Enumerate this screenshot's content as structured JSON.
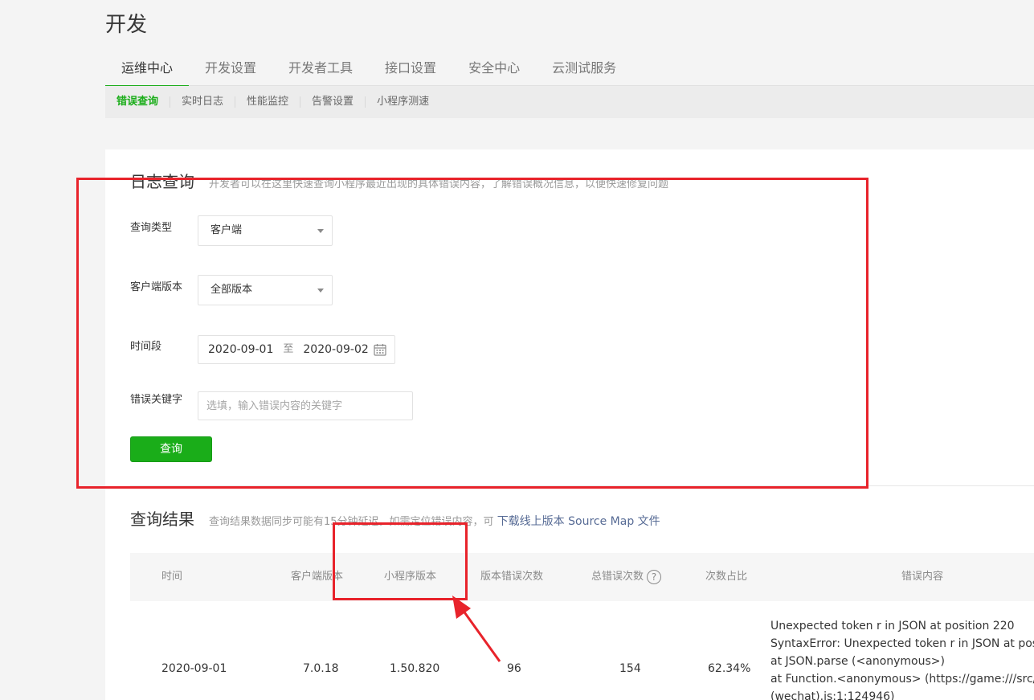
{
  "page": {
    "title": "开发"
  },
  "main_tabs": [
    {
      "label": "运维中心",
      "active": true
    },
    {
      "label": "开发设置",
      "active": false
    },
    {
      "label": "开发者工具",
      "active": false
    },
    {
      "label": "接口设置",
      "active": false
    },
    {
      "label": "安全中心",
      "active": false
    },
    {
      "label": "云测试服务",
      "active": false
    }
  ],
  "sub_tabs": [
    {
      "label": "错误查询",
      "active": true
    },
    {
      "label": "实时日志",
      "active": false
    },
    {
      "label": "性能监控",
      "active": false
    },
    {
      "label": "告警设置",
      "active": false
    },
    {
      "label": "小程序测速",
      "active": false
    }
  ],
  "log_query": {
    "title": "日志查询",
    "desc": "开发者可以在这里快速查询小程序最近出现的具体错误内容，了解错误概况信息，以便快速修复问题",
    "query_type_label": "查询类型",
    "query_type_value": "客户端",
    "client_version_label": "客户端版本",
    "client_version_value": "全部版本",
    "period_label": "时间段",
    "date_start": "2020-09-01",
    "date_sep": "至",
    "date_end": "2020-09-02",
    "keyword_label": "错误关键字",
    "keyword_placeholder": "选填，输入错误内容的关键字",
    "keyword_value": "",
    "query_button": "查询"
  },
  "results": {
    "title": "查询结果",
    "desc": "查询结果数据同步可能有15分钟延迟。如需定位错误内容，可",
    "link": "下载线上版本 Source Map 文件",
    "columns": {
      "time": "时间",
      "client_version": "客户端版本",
      "mp_version": "小程序版本",
      "version_errors": "版本错误次数",
      "total_errors": "总错误次数",
      "ratio": "次数占比",
      "error_content": "错误内容"
    },
    "rows": [
      {
        "time": "2020-09-01",
        "client_version": "7.0.18",
        "mp_version": "1.50.820",
        "version_errors": "96",
        "total_errors": "154",
        "ratio": "62.34%",
        "error_lines": [
          "Unexpected token r in JSON at position 220",
          "SyntaxError: Unexpected token r in JSON at posit",
          "at JSON.parse (<anonymous>)",
          "at Function.<anonymous> (https://game:///src/a",
          "(wechat).js:1:124946)"
        ]
      }
    ]
  },
  "colors": {
    "accent": "#1aad19",
    "annotation": "#e8232b",
    "link": "#576b95"
  },
  "icons": {
    "calendar": "calendar-icon",
    "help": "help-circle-icon",
    "caret": "caret-down-icon"
  }
}
